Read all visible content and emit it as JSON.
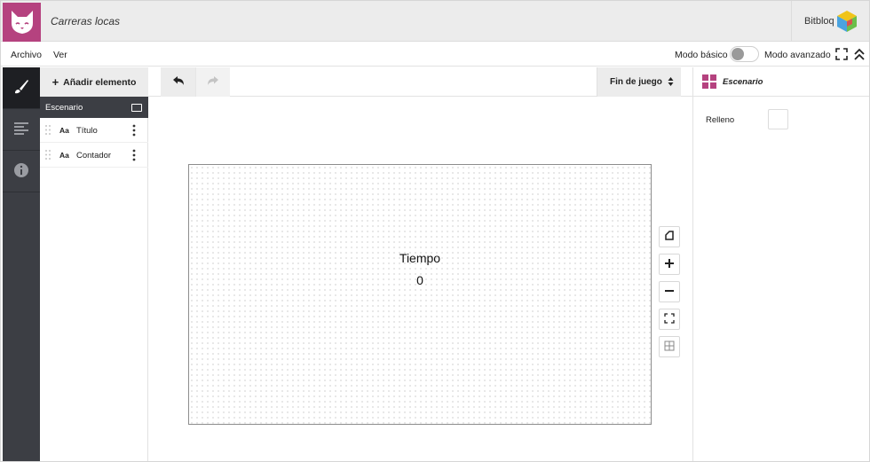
{
  "header": {
    "document_title": "Carreras locas",
    "brand_name": "Bitbloq",
    "logo_icon": "fox-logo-icon",
    "brand_logo_icon": "bitbloq-cube-icon",
    "accent_color": "#b5427f"
  },
  "menu": {
    "items": [
      "Archivo",
      "Ver"
    ],
    "mode_basic_label": "Modo básico",
    "mode_advanced_label": "Modo avanzado",
    "mode_toggle_checked": false
  },
  "sidebar": {
    "tabs": [
      {
        "icon": "brush-icon",
        "active": true
      },
      {
        "icon": "align-left-icon",
        "active": false
      },
      {
        "icon": "info-icon",
        "active": false
      }
    ]
  },
  "elements_panel": {
    "add_label": "Añadir elemento",
    "scene_label": "Escenario",
    "items": [
      {
        "type_label": "Aa",
        "name": "Título"
      },
      {
        "type_label": "Aa",
        "name": "Contador"
      }
    ]
  },
  "toolbar": {
    "undo_icon": "undo-icon",
    "redo_icon": "redo-icon",
    "scene_select_value": "Fin de juego"
  },
  "stage": {
    "title_text": "Tiempo",
    "counter_value": "0"
  },
  "zoom_controls": [
    "shape-icon",
    "zoom-in-icon",
    "zoom-out-icon",
    "fit-screen-icon",
    "grid-icon"
  ],
  "properties": {
    "header_label": "Escenario",
    "fill_label": "Relleno",
    "fill_color": "#ffffff"
  }
}
